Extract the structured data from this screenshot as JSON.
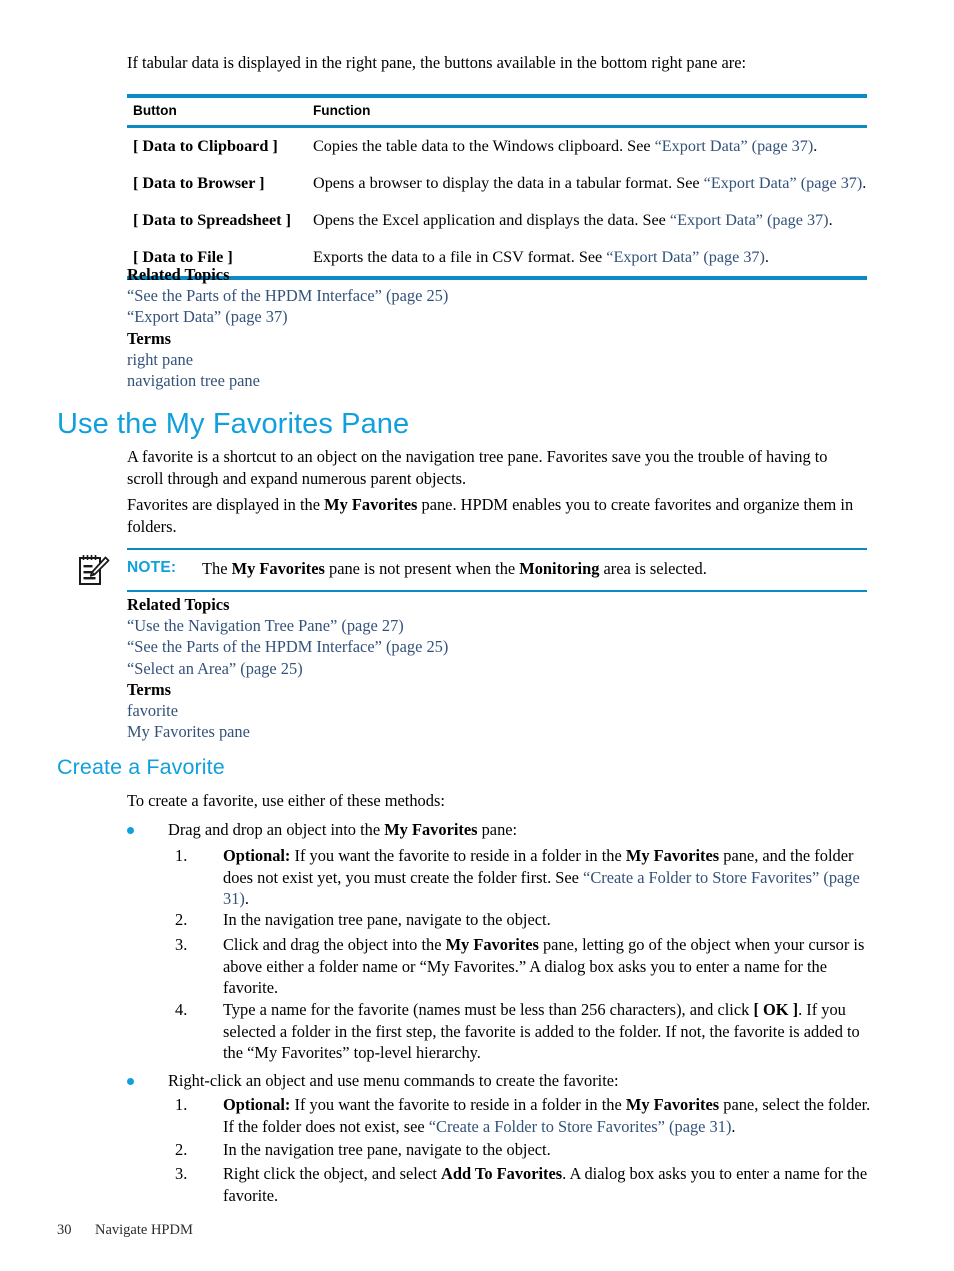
{
  "colors": {
    "heading": "#11a0dc",
    "rule": "#0b8ac4",
    "link": "#33527a",
    "bullet": "#11a0dc",
    "text": "#000000"
  },
  "intro": {
    "text": "If tabular data is displayed in the right pane, the buttons available in the bottom right pane are:"
  },
  "table": {
    "headers": [
      "Button",
      "Function"
    ],
    "rows": [
      {
        "button": "[ Data to Clipboard ]",
        "function_pre": "Copies the table data to the Windows clipboard. See ",
        "function_link": "“Export Data” (page 37)",
        "function_post": "."
      },
      {
        "button": "[ Data to Browser ]",
        "function_pre": "Opens a browser to display the data in a tabular format. See ",
        "function_link": "“Export Data” (page 37)",
        "function_post": "."
      },
      {
        "button": "[ Data to Spreadsheet ]",
        "function_pre": "Opens the Excel application and displays the data. See ",
        "function_link": "“Export Data” (page 37)",
        "function_post": "."
      },
      {
        "button": "[ Data to File ]",
        "function_pre": "Exports the data to a file in CSV format. See ",
        "function_link": "“Export Data” (page 37)",
        "function_post": "."
      }
    ]
  },
  "related_topics_1": {
    "heading": "Related Topics",
    "links": [
      "“See the Parts of the HPDM Interface” (page 25)",
      "“Export Data” (page 37)"
    ],
    "terms_heading": "Terms",
    "terms": [
      "right pane",
      "navigation tree pane"
    ]
  },
  "section": {
    "title": "Use the My Favorites Pane",
    "para1_a": "A favorite is a shortcut to an object on the navigation tree pane. Favorites save you the trouble of having to scroll through and expand numerous parent objects.",
    "para2_a": "Favorites are displayed in the ",
    "para2_b": "My Favorites",
    "para2_c": " pane. HPDM enables you to create favorites and organize them in folders."
  },
  "note": {
    "icon": "notepad-pencil-icon",
    "label": "NOTE:",
    "text_a": "The ",
    "text_b": "My Favorites",
    "text_c": " pane is not present when the ",
    "text_d": "Monitoring",
    "text_e": " area is selected."
  },
  "related_topics_2": {
    "heading": "Related Topics",
    "links": [
      "“Use the Navigation Tree Pane” (page 27)",
      "“See the Parts of the HPDM Interface” (page 25)",
      "“Select an Area” (page 25)"
    ],
    "terms_heading": "Terms",
    "terms": [
      "favorite",
      "My Favorites pane"
    ]
  },
  "subsection": {
    "title": "Create a Favorite",
    "intro": "To create a favorite, use either of these methods:"
  },
  "method1": {
    "bullet_a": "Drag and drop an object into the ",
    "bullet_b": "My Favorites",
    "bullet_c": " pane:",
    "steps": [
      {
        "marker": "1.",
        "bold": "Optional:",
        "a": " If you want the favorite to reside in a folder in the ",
        "b": "My Favorites",
        "c": " pane, and the folder does not exist yet, you must create the folder first. See ",
        "link": "“Create a Folder to Store Favorites” (page 31)",
        "d": "."
      },
      {
        "marker": "2.",
        "a": "In the navigation tree pane, navigate to the object."
      },
      {
        "marker": "3.",
        "a": "Click and drag the object into the ",
        "b": "My Favorites",
        "c": " pane, letting go of the object when your cursor is above either a folder name or “My Favorites.” A dialog box asks you to enter a name for the favorite."
      },
      {
        "marker": "4.",
        "a": "Type a name for the favorite (names must be less than 256 characters), and click ",
        "b": "[ OK ]",
        "c": ". If you selected a folder in the first step, the favorite is added to the folder. If not, the favorite is added to the “My Favorites” top-level hierarchy."
      }
    ]
  },
  "method2": {
    "bullet_a": "Right-click an object and use menu commands to create the favorite:",
    "steps": [
      {
        "marker": "1.",
        "bold": "Optional:",
        "a": " If you want the favorite to reside in a folder in the ",
        "b": "My Favorites",
        "c": " pane, select the folder. If the folder does not exist, see ",
        "link": "“Create a Folder to Store Favorites” (page 31)",
        "d": "."
      },
      {
        "marker": "2.",
        "a": "In the navigation tree pane, navigate to the object."
      },
      {
        "marker": "3.",
        "a": "Right click the object, and select ",
        "b": "Add To Favorites",
        "c": ". A dialog box asks you to enter a name for the favorite."
      }
    ]
  },
  "footer": {
    "page_number": "30",
    "chapter": "Navigate HPDM"
  }
}
